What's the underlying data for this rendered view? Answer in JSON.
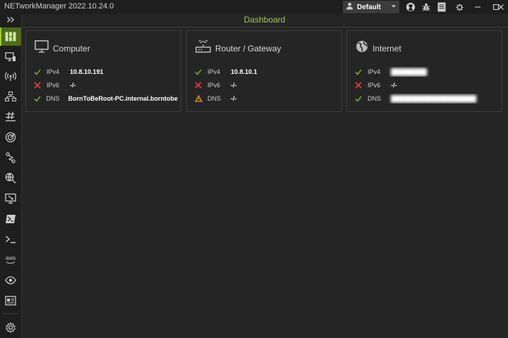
{
  "app": {
    "title": "NETworkManager 2022.10.24.0"
  },
  "titlebar": {
    "profile_value": "Default",
    "icons": [
      "github-icon",
      "bug-icon",
      "document-icon"
    ],
    "window_controls": [
      "settings-gear-icon",
      "minimize-icon",
      "maximize-icon",
      "close-icon"
    ]
  },
  "header": {
    "title": "Dashboard"
  },
  "sidebar": {
    "items": [
      "collapse-chevron-icon",
      "dashboard-icon",
      "network-interface-icon",
      "wifi-icon",
      "ip-scanner-icon",
      "port-scanner-icon",
      "ping-monitor-icon",
      "traceroute-icon",
      "dns-lookup-icon",
      "remote-desktop-icon",
      "powershell-icon",
      "terminal-icon",
      "aws-icon",
      "tigervnc-icon",
      "web-console-icon",
      "settings-icon"
    ],
    "aws_text": "aws"
  },
  "cards": [
    {
      "title": "Computer",
      "rows": [
        {
          "status": "ok",
          "label": "IPv4",
          "value": "10.8.10.191"
        },
        {
          "status": "error",
          "label": "IPv6",
          "value": "-/-"
        },
        {
          "status": "ok",
          "label": "DNS",
          "value": "BornToBeRoot-PC.internal.borntobe"
        }
      ]
    },
    {
      "title": "Router / Gateway",
      "rows": [
        {
          "status": "ok",
          "label": "IPv4",
          "value": "10.8.10.1"
        },
        {
          "status": "error",
          "label": "IPv6",
          "value": "-/-"
        },
        {
          "status": "warning",
          "label": "DNS",
          "value": "-/-"
        }
      ]
    },
    {
      "title": "Internet",
      "rows": [
        {
          "status": "ok",
          "label": "IPv4",
          "value": "████████",
          "blurred": true
        },
        {
          "status": "error",
          "label": "IPv6",
          "value": "-/-"
        },
        {
          "status": "ok",
          "label": "DNS",
          "value": "███████████████████",
          "blurred": true
        }
      ]
    }
  ],
  "colors": {
    "ok": "#8ab933",
    "error": "#e0393e",
    "warning": "#e89a1e",
    "accent": "#a6c35a"
  }
}
